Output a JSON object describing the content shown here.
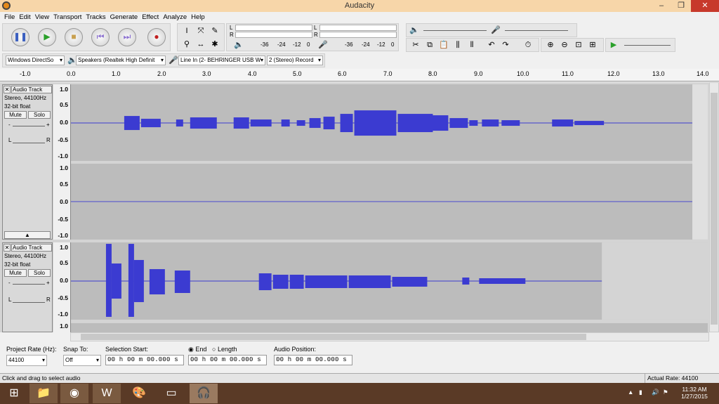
{
  "window": {
    "title": "Audacity",
    "min": "–",
    "max": "❐",
    "close": "✕"
  },
  "menu": [
    "File",
    "Edit",
    "View",
    "Transport",
    "Tracks",
    "Generate",
    "Effect",
    "Analyze",
    "Help"
  ],
  "meters": {
    "rec_L": "L",
    "rec_R": "R",
    "play_L": "L",
    "play_R": "R",
    "ticks": [
      "-36",
      "-24",
      "-12",
      "0"
    ]
  },
  "devices": {
    "host": "Windows DirectSo",
    "output": "Speakers (Realtek High Definit",
    "input": "Line In (2- BEHRINGER USB W",
    "channels": "2 (Stereo) Record"
  },
  "ruler": [
    "-1.0",
    "0.0",
    "1.0",
    "2.0",
    "3.0",
    "4.0",
    "5.0",
    "6.0",
    "7.0",
    "8.0",
    "9.0",
    "10.0",
    "11.0",
    "12.0",
    "13.0",
    "14.0"
  ],
  "track1": {
    "name": "Audio Track",
    "rate": "Stereo, 44100Hz",
    "format": "32-bit float",
    "mute": "Mute",
    "solo": "Solo",
    "gain_minus": "-",
    "gain_plus": "+",
    "pan_l": "L",
    "pan_r": "R",
    "scale_top": [
      "1.0",
      "0.5",
      "0.0",
      "-0.5",
      "-1.0"
    ],
    "scale_bot": [
      "1.0",
      "0.5",
      "0.0",
      "-0.5",
      "-1.0"
    ]
  },
  "track2": {
    "name": "Audio Track",
    "rate": "Stereo, 44100Hz",
    "format": "32-bit float",
    "mute": "Mute",
    "solo": "Solo",
    "gain_minus": "-",
    "gain_plus": "+",
    "pan_l": "L",
    "pan_r": "R",
    "scale_top": [
      "1.0",
      "0.5",
      "0.0",
      "-0.5",
      "-1.0"
    ],
    "scale_next": "1.0"
  },
  "selection": {
    "rate_label": "Project Rate (Hz):",
    "rate": "44100",
    "snap_label": "Snap To:",
    "snap": "Off",
    "start_label": "Selection Start:",
    "end_label": "End",
    "length_label": "Length",
    "pos_label": "Audio Position:",
    "start": "00 h 00 m 00.000 s",
    "end": "00 h 00 m 00.000 s",
    "pos": "00 h 00 m 00.000 s"
  },
  "status": {
    "left": "Click and drag to select audio",
    "right": "Actual Rate: 44100"
  },
  "taskbar": {
    "time": "11:32 AM",
    "date": "1/27/2015"
  },
  "colors": {
    "wave": "#3b3bd1",
    "wavebg": "#bcbcbc",
    "title": "#f7d6a9",
    "taskbar": "#5a3a26"
  }
}
